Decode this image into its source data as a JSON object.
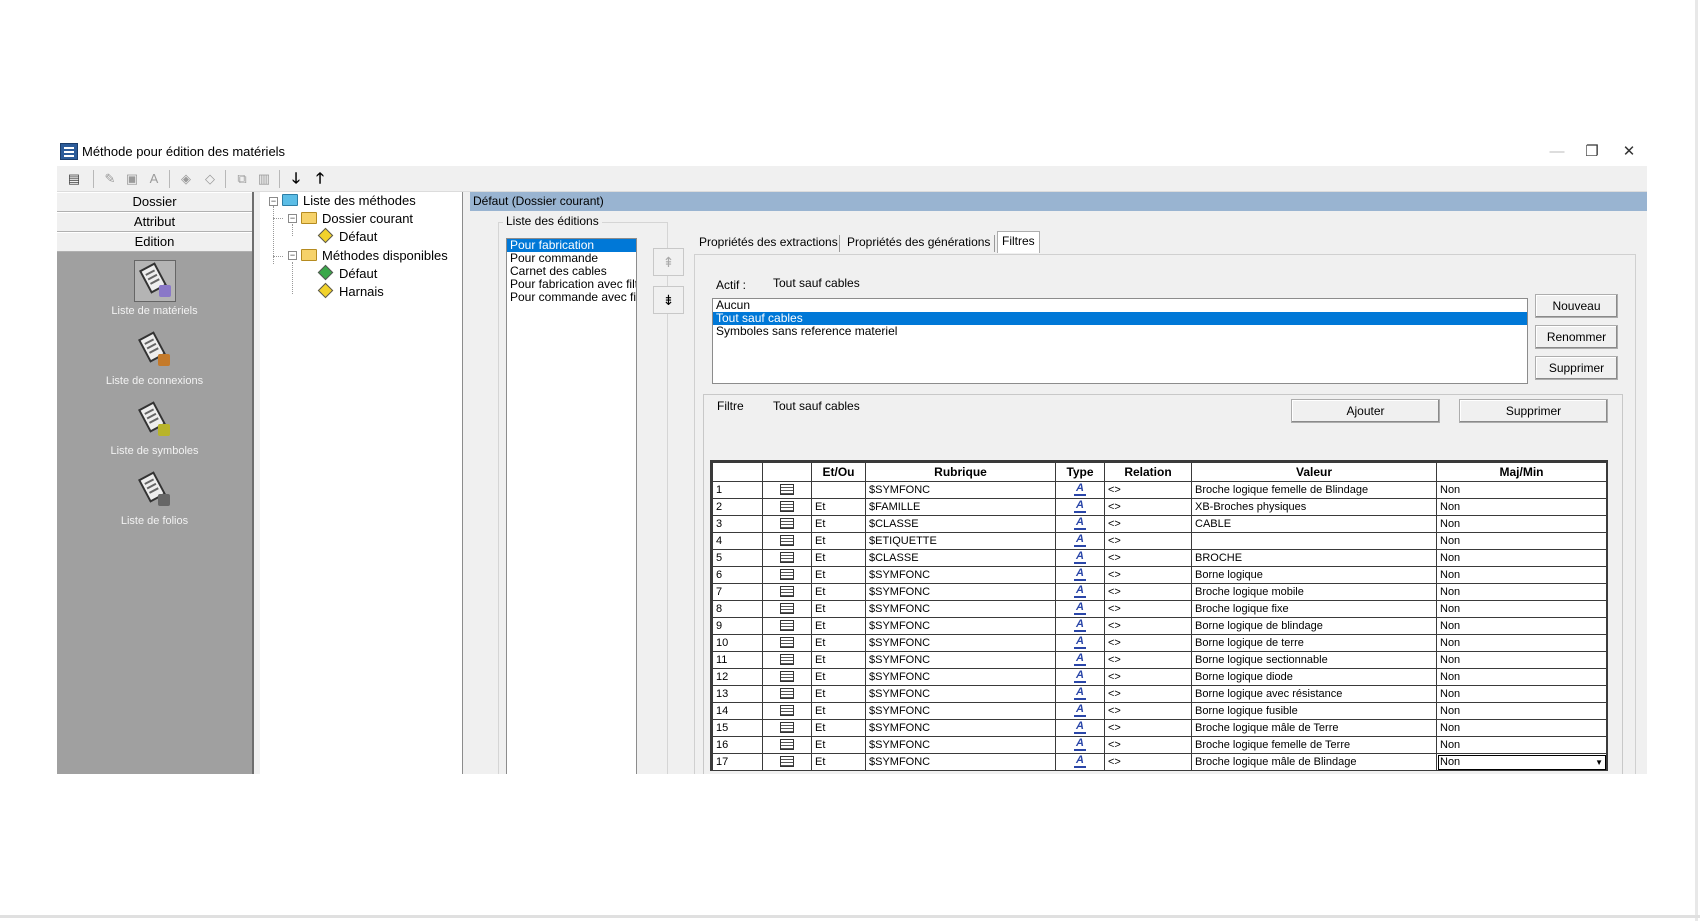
{
  "window": {
    "title": "Méthode pour édition des matériels",
    "controls": {
      "minimize": "—",
      "restore": "❐",
      "close": "✕"
    }
  },
  "toolbar": {
    "icons": [
      "new-method-icon",
      "pencil-icon",
      "image-icon",
      "font-icon",
      "target-icon",
      "diamond-icon",
      "copy-icon",
      "paste-icon",
      "arrow-down-icon",
      "arrow-up-icon"
    ],
    "arrow_down": "🡓",
    "arrow_up": "🡑"
  },
  "nav": {
    "buttons": [
      "Dossier",
      "Attribut",
      "Edition"
    ],
    "items": [
      {
        "label": "Liste de matériels",
        "icon": "materials-list-icon",
        "accent": "#8a78c8"
      },
      {
        "label": "Liste de connexions",
        "icon": "connections-list-icon",
        "accent": "#c47a2a"
      },
      {
        "label": "Liste de symboles",
        "icon": "symbols-list-icon",
        "accent": "#b8b42a"
      },
      {
        "label": "Liste de folios",
        "icon": "folios-list-icon",
        "accent": "#666666"
      }
    ]
  },
  "tree": {
    "root": "Liste des méthodes",
    "group1": "Dossier courant",
    "group1_items": [
      "Défaut"
    ],
    "group2": "Méthodes disponibles",
    "group2_items": [
      "Défaut",
      "Harnais"
    ],
    "colors": {
      "green_diamond": "#3aa84a",
      "yellow_diamond": "#f2d22a"
    }
  },
  "main": {
    "header": "Défaut (Dossier courant)",
    "editions_label": "Liste des éditions",
    "editions": [
      "Pour fabrication",
      "Pour commande",
      "Carnet des cables",
      "Pour fabrication avec filt",
      "Pour commande avec fil"
    ],
    "editions_selected": 0,
    "move_up": "⇞",
    "move_down": "⇟",
    "tabs": [
      "Propriétés des extractions",
      "Propriétés des générations",
      "Filtres"
    ],
    "active_tab": 2,
    "actif_label": "Actif :",
    "actif_value": "Tout sauf cables",
    "filters": [
      "Aucun",
      "Tout sauf cables",
      "Symboles sans reference materiel"
    ],
    "filters_selected": 1,
    "buttons": {
      "nouveau": "Nouveau",
      "renommer": "Renommer",
      "supprimer": "Supprimer"
    },
    "filtre_label": "Filtre",
    "filtre_value": "Tout sauf cables",
    "ajouter": "Ajouter",
    "supprimer2": "Supprimer"
  },
  "grid": {
    "headers": [
      "",
      "",
      "Et/Ou",
      "Rubrique",
      "Type",
      "Relation",
      "Valeur",
      "Maj/Min"
    ],
    "type_glyph": "A",
    "rows": [
      [
        "1",
        "",
        "$SYMFONC",
        "<>",
        "Broche logique femelle de Blindage",
        "Non"
      ],
      [
        "2",
        "Et",
        "$FAMILLE",
        "<>",
        "XB-Broches physiques",
        "Non"
      ],
      [
        "3",
        "Et",
        "$CLASSE",
        "<>",
        "CABLE",
        "Non"
      ],
      [
        "4",
        "Et",
        "$ETIQUETTE",
        "<>",
        "",
        "Non"
      ],
      [
        "5",
        "Et",
        "$CLASSE",
        "<>",
        "BROCHE",
        "Non"
      ],
      [
        "6",
        "Et",
        "$SYMFONC",
        "<>",
        "Borne logique",
        "Non"
      ],
      [
        "7",
        "Et",
        "$SYMFONC",
        "<>",
        "Broche logique mobile",
        "Non"
      ],
      [
        "8",
        "Et",
        "$SYMFONC",
        "<>",
        "Broche logique fixe",
        "Non"
      ],
      [
        "9",
        "Et",
        "$SYMFONC",
        "<>",
        "Borne logique de blindage",
        "Non"
      ],
      [
        "10",
        "Et",
        "$SYMFONC",
        "<>",
        "Borne logique de terre",
        "Non"
      ],
      [
        "11",
        "Et",
        "$SYMFONC",
        "<>",
        "Borne logique sectionnable",
        "Non"
      ],
      [
        "12",
        "Et",
        "$SYMFONC",
        "<>",
        "Borne logique diode",
        "Non"
      ],
      [
        "13",
        "Et",
        "$SYMFONC",
        "<>",
        "Borne logique avec résistance",
        "Non"
      ],
      [
        "14",
        "Et",
        "$SYMFONC",
        "<>",
        "Borne logique fusible",
        "Non"
      ],
      [
        "15",
        "Et",
        "$SYMFONC",
        "<>",
        "Broche logique mâle de Terre",
        "Non"
      ],
      [
        "16",
        "Et",
        "$SYMFONC",
        "<>",
        "Broche logique femelle de Terre",
        "Non"
      ],
      [
        "17",
        "Et",
        "$SYMFONC",
        "<>",
        "Broche logique mâle de Blindage",
        "Non"
      ]
    ],
    "editing_row": 16
  }
}
